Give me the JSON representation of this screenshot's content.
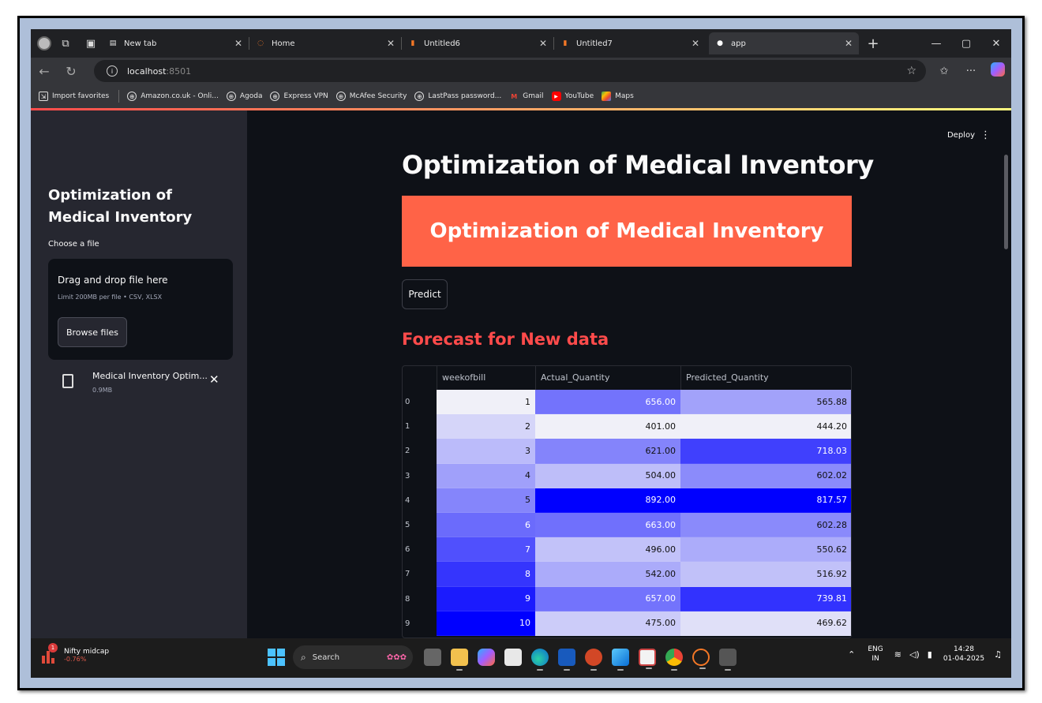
{
  "browser": {
    "tabs": [
      {
        "label": "New tab",
        "favicon": "newtab-icon",
        "active": false
      },
      {
        "label": "Home",
        "favicon": "jupyter-icon",
        "active": false
      },
      {
        "label": "Untitled6",
        "favicon": "notebook-icon",
        "active": false
      },
      {
        "label": "Untitled7",
        "favicon": "notebook-icon",
        "active": false
      },
      {
        "label": "app",
        "favicon": "streamlit-icon",
        "active": true
      }
    ],
    "new_tab_glyph": "+",
    "url_host": "localhost",
    "url_port": ":8501",
    "bookmarks": [
      {
        "label": "Import favorites"
      },
      {
        "label": "Amazon.co.uk - Onli..."
      },
      {
        "label": "Agoda"
      },
      {
        "label": "Express VPN"
      },
      {
        "label": "McAfee Security"
      },
      {
        "label": "LastPass password..."
      },
      {
        "label": "Gmail"
      },
      {
        "label": "YouTube"
      },
      {
        "label": "Maps"
      }
    ]
  },
  "sidebar": {
    "title": "Optimization of Medical Inventory",
    "uploader_label": "Choose a file",
    "drop_text": "Drag and drop file here",
    "limit_text": "Limit 200MB per file • CSV, XLSX",
    "browse_label": "Browse files",
    "file_name": "Medical Inventory Optim...",
    "file_size": "0.9MB"
  },
  "main": {
    "deploy_label": "Deploy",
    "heading": "Optimization of Medical Inventory",
    "banner": "Optimization of Medical Inventory",
    "predict_label": "Predict",
    "subheading": "Forecast for New data",
    "table": {
      "columns": [
        "",
        "weekofbill",
        "Actual_Quantity",
        "Predicted_Quantity"
      ],
      "rows": [
        {
          "index": "0",
          "weekofbill": "1",
          "actual": "656.00",
          "predicted": "565.88"
        },
        {
          "index": "1",
          "weekofbill": "2",
          "actual": "401.00",
          "predicted": "444.20"
        },
        {
          "index": "2",
          "weekofbill": "3",
          "actual": "621.00",
          "predicted": "718.03"
        },
        {
          "index": "3",
          "weekofbill": "4",
          "actual": "504.00",
          "predicted": "602.02"
        },
        {
          "index": "4",
          "weekofbill": "5",
          "actual": "892.00",
          "predicted": "817.57"
        },
        {
          "index": "5",
          "weekofbill": "6",
          "actual": "663.00",
          "predicted": "602.28"
        },
        {
          "index": "6",
          "weekofbill": "7",
          "actual": "496.00",
          "predicted": "550.62"
        },
        {
          "index": "7",
          "weekofbill": "8",
          "actual": "542.00",
          "predicted": "516.92"
        },
        {
          "index": "8",
          "weekofbill": "9",
          "actual": "657.00",
          "predicted": "739.81"
        },
        {
          "index": "9",
          "weekofbill": "10",
          "actual": "475.00",
          "predicted": "469.62"
        }
      ]
    }
  },
  "taskbar": {
    "stock_badge": "1",
    "stock_name": "Nifty midcap",
    "stock_change": "-0.76%",
    "search_label": "Search",
    "lang_line1": "ENG",
    "lang_line2": "IN",
    "time": "14:28",
    "date": "01-04-2025"
  },
  "colors": {
    "banner": "#ff6347",
    "subheading": "#ff4b4b",
    "heat_high": "#0000ff",
    "heat_low": "#f0f0f8"
  }
}
